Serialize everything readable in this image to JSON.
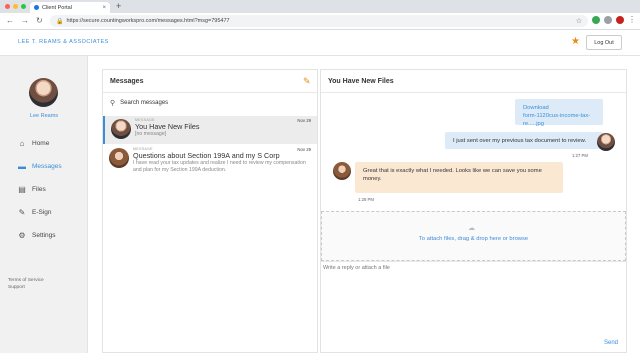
{
  "browser": {
    "tab_title": "Client Portal",
    "tab_close": "×",
    "new_tab": "+",
    "url": "https://secure.countingworkspro.com/messages.html?msg=795477",
    "colors": {
      "close_dot": "#ff5f57",
      "min_dot": "#febc2e",
      "max_dot": "#28c840"
    }
  },
  "header": {
    "brand": "LEE T. REAMS & ASSOCIATES",
    "logout": "Log Out",
    "accent": "#e88a16"
  },
  "sidebar": {
    "user_name": "Lee Reams",
    "items": [
      {
        "label": "Home",
        "icon": "home-icon",
        "active": false
      },
      {
        "label": "Messages",
        "icon": "chat-icon",
        "active": true
      },
      {
        "label": "Files",
        "icon": "file-icon",
        "active": false
      },
      {
        "label": "E-Sign",
        "icon": "pen-icon",
        "active": false
      },
      {
        "label": "Settings",
        "icon": "gear-icon",
        "active": false
      }
    ],
    "footer": {
      "terms": "Terms of Service",
      "support": "Support"
    }
  },
  "messages": {
    "title": "Messages",
    "search_label": "Search messages",
    "conversations": [
      {
        "from": "MESSAGE",
        "subject": "You Have New Files",
        "preview": "[no message]",
        "date": "Nov 29"
      },
      {
        "from": "MESSAGE",
        "subject": "Questions about Section 199A and my S Corp",
        "preview": "I have read your tax updates and realize I need to review my compensation and plan for my Section 199A deduction.",
        "date": "Nov 29"
      }
    ]
  },
  "thread": {
    "title": "You Have New Files",
    "download_label": "Download",
    "file_name": "form-1120cus-income-tax-re.....jpg",
    "msg_sent": "I just sent over my previous tax document to review.",
    "time_sent": "1:27 PM",
    "msg_reply": "Great that is exactly what I needed. Looks like we can save you some money.",
    "time_reply": "1:28 PM",
    "dropzone_text": "To attach files, drag & drop here or browse",
    "reply_placeholder": "Write a reply or attach a file",
    "send": "Send"
  }
}
